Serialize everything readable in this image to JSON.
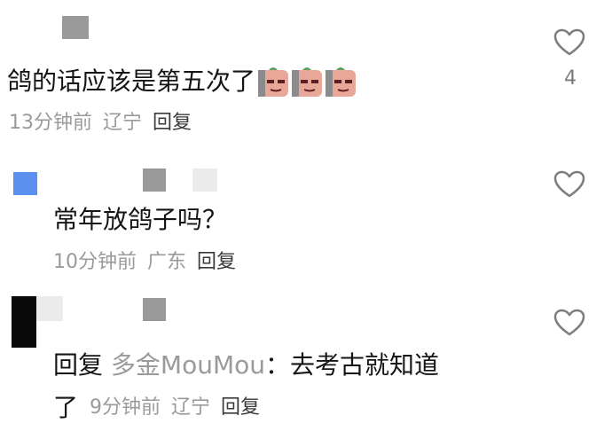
{
  "comment1": {
    "text": "鸽的话应该是第五次了",
    "emojis": [
      "doge-sweat-emoji",
      "doge-sweat-emoji",
      "doge-sweat-emoji"
    ],
    "time": "13分钟前",
    "location": "辽宁",
    "reply": "回复",
    "likes": "4"
  },
  "comment2": {
    "text": "常年放鸽子吗？",
    "time": "10分钟前",
    "location": "广东",
    "reply": "回复"
  },
  "comment3": {
    "reply_prefix": "回复",
    "reply_to": "多金MouMou",
    "colon": "：",
    "text_line1": "去考古就知道",
    "text_line2": "了",
    "time": "9分钟前",
    "location": "辽宁",
    "reply": "回复"
  },
  "colors": {
    "accent_blue": "#5b8ff0",
    "text": "#151515",
    "meta": "#9a9a9a"
  }
}
